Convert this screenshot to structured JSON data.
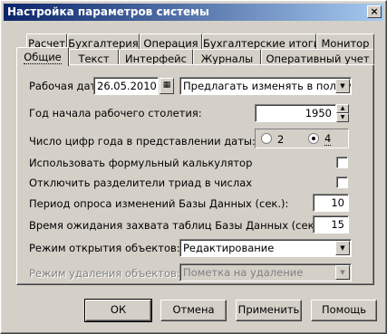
{
  "window": {
    "title": "Настройка параметров системы",
    "close_glyph": "×"
  },
  "tabs_row_top": [
    "Расчет",
    "Бухгалтерия",
    "Операция",
    "Бухгалтерские итоги",
    "Монитор"
  ],
  "tabs_row_bottom": [
    "Общие",
    "Текст",
    "Интерфейс",
    "Журналы",
    "Оперативный учет"
  ],
  "active_tab": "Общие",
  "form": {
    "work_date_label": "Рабочая дата:",
    "work_date_value": "26.05.2010",
    "calendar_icon": "calendar-icon",
    "date_mode_value": "Предлагать изменять в полночь",
    "century_label": "Год начала рабочего столетия:",
    "century_value": "1950",
    "year_digits_label": "Число цифр года в представлении даты:",
    "year_digits_options": [
      "2",
      "4"
    ],
    "year_digits_selected": "4",
    "calculator_label": "Использовать формульный калькулятор",
    "calculator_checked": false,
    "triad_label": "Отключить разделители триад в числах",
    "triad_checked": false,
    "poll_period_label": "Период опроса изменений Базы Данных (сек.):",
    "poll_period_value": "10",
    "lock_wait_label": "Время ожидания захвата таблиц Базы Данных (сек.):",
    "lock_wait_value": "15",
    "open_mode_label": "Режим открытия объектов:",
    "open_mode_value": "Редактирование",
    "delete_mode_label": "Режим удаления объектов:",
    "delete_mode_value": "Пометка на удаление"
  },
  "buttons": {
    "ok": "ОК",
    "cancel": "Отмена",
    "apply": "Применить",
    "help": "Помощь"
  }
}
